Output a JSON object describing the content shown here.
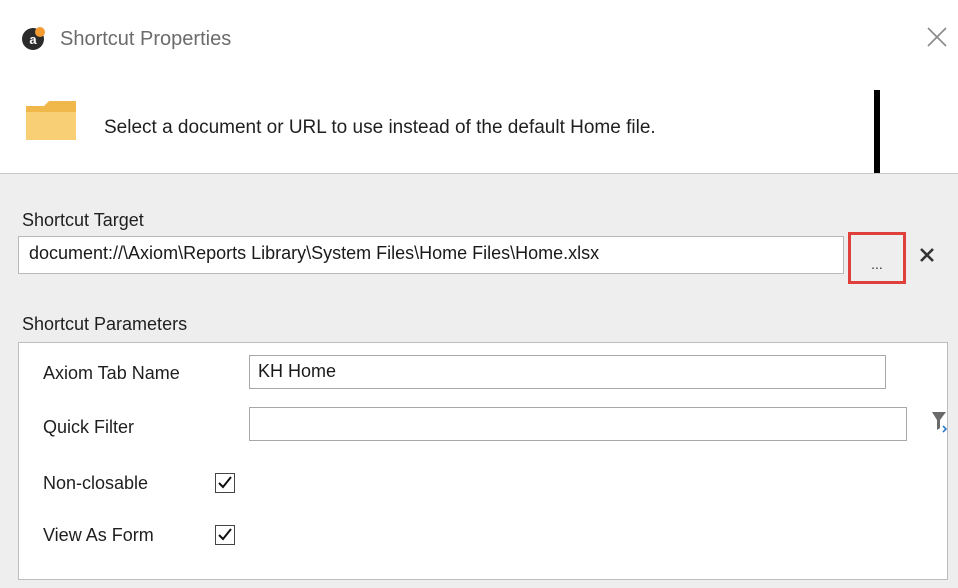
{
  "window": {
    "title": "Shortcut Properties",
    "app_icon_letter": "a"
  },
  "header": {
    "instruction": "Select a document or URL to use instead of the default Home file."
  },
  "shortcut_target": {
    "label": "Shortcut Target",
    "value": "document://\\Axiom\\Reports Library\\System Files\\Home Files\\Home.xlsx",
    "browse_label": "..."
  },
  "shortcut_parameters": {
    "label": "Shortcut Parameters",
    "tab_name_label": "Axiom Tab Name",
    "tab_name_value": "KH Home",
    "quick_filter_label": "Quick Filter",
    "quick_filter_value": "",
    "non_closable_label": "Non-closable",
    "non_closable_checked": true,
    "view_as_form_label": "View As Form",
    "view_as_form_checked": true
  },
  "colors": {
    "highlight_border": "#e0403c",
    "folder_yellow": "#f5c762",
    "app_accent": "#f39c34"
  }
}
